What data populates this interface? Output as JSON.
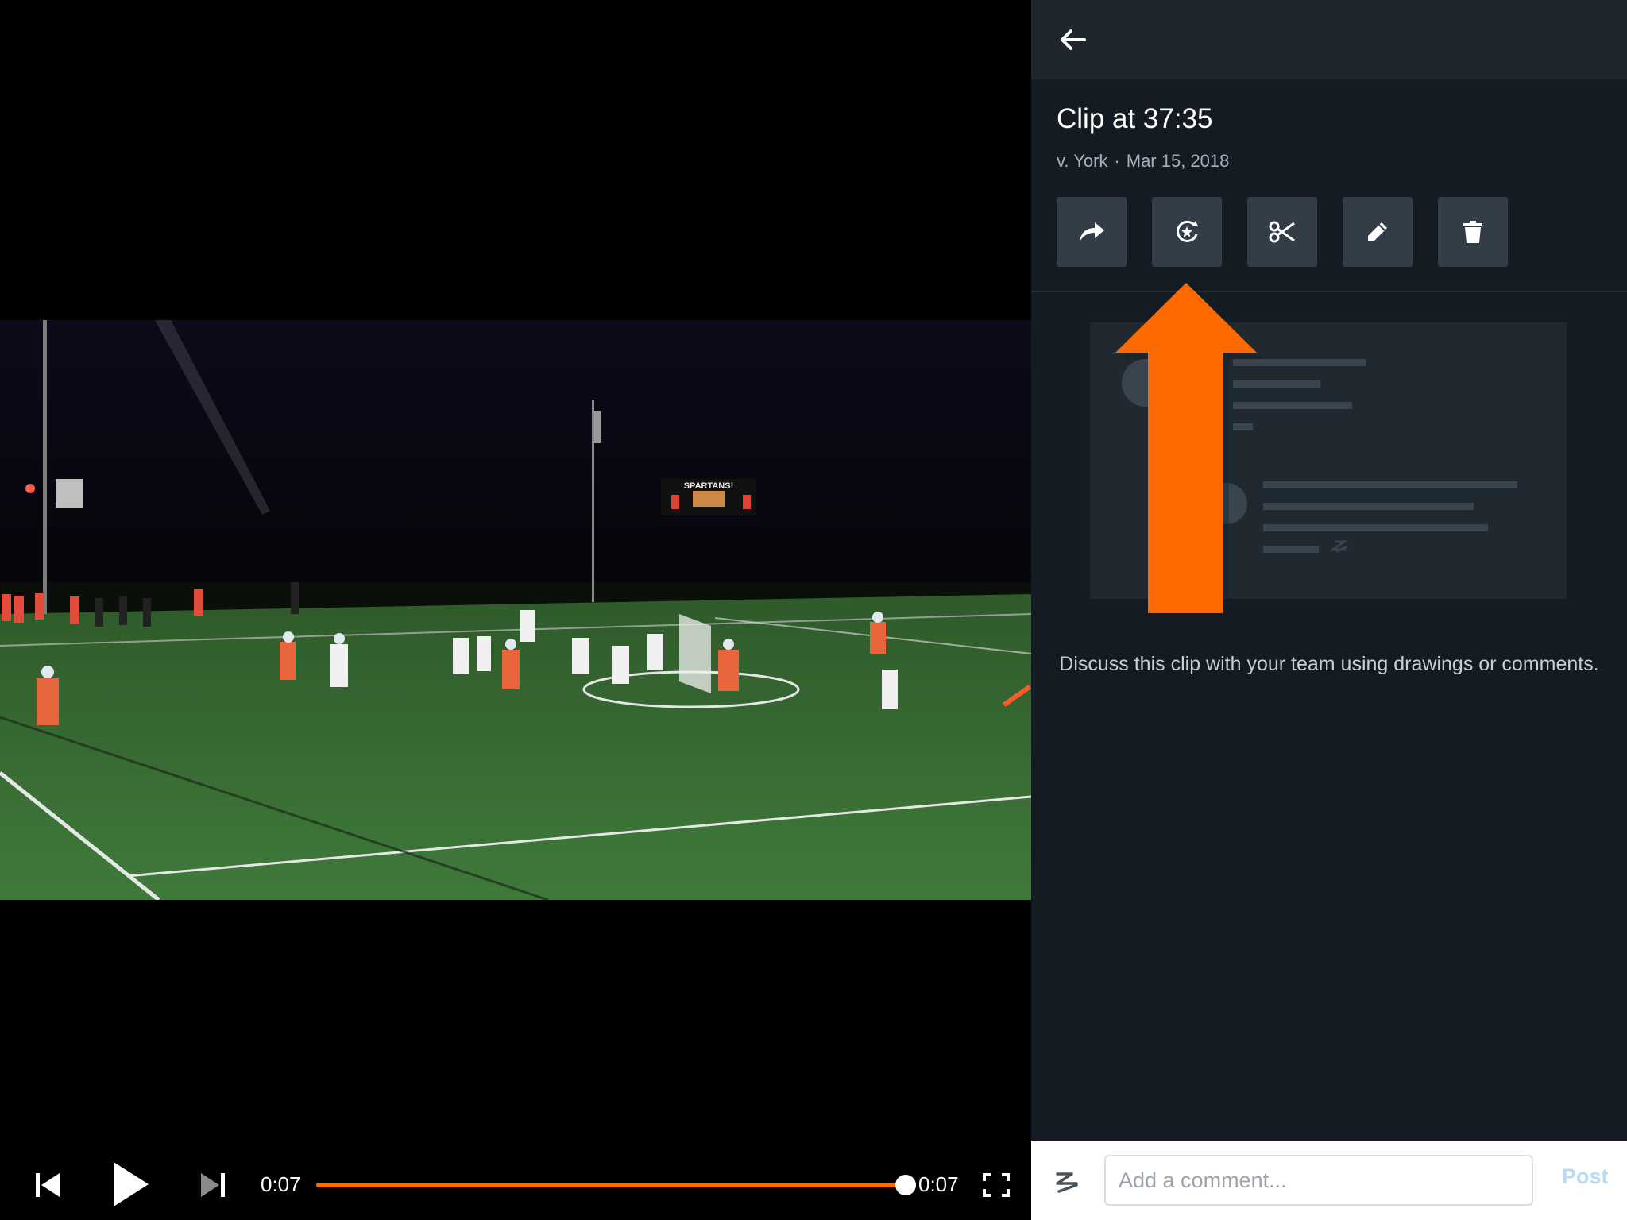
{
  "player": {
    "current_time": "0:07",
    "duration": "0:07",
    "progress_fraction": 1.0,
    "accent_color": "#ff6a00",
    "controls": {
      "previous_icon": "skip-previous-icon",
      "play_icon": "play-icon",
      "next_icon": "skip-next-icon",
      "fullscreen_icon": "fullscreen-icon"
    },
    "scoreboard": {
      "banner": "SPARTANS!"
    }
  },
  "panel": {
    "back_icon": "arrow-left-icon",
    "title": "Clip at 37:35",
    "opponent": "v. York",
    "separator": "·",
    "date": "Mar 15, 2018",
    "actions": [
      {
        "name": "share",
        "icon": "share-icon"
      },
      {
        "name": "highlight",
        "icon": "highlight-star-icon"
      },
      {
        "name": "trim",
        "icon": "scissors-icon"
      },
      {
        "name": "edit",
        "icon": "pencil-icon"
      },
      {
        "name": "delete",
        "icon": "trash-icon"
      }
    ],
    "empty_state_message": "Discuss this clip with your team using drawings or comments.",
    "annotation_arrow_color": "#ff6a00"
  },
  "comment": {
    "draw_icon": "drawing-squiggle-icon",
    "placeholder": "Add a comment...",
    "post_label": "Post",
    "post_color": "#b7dcf3"
  }
}
